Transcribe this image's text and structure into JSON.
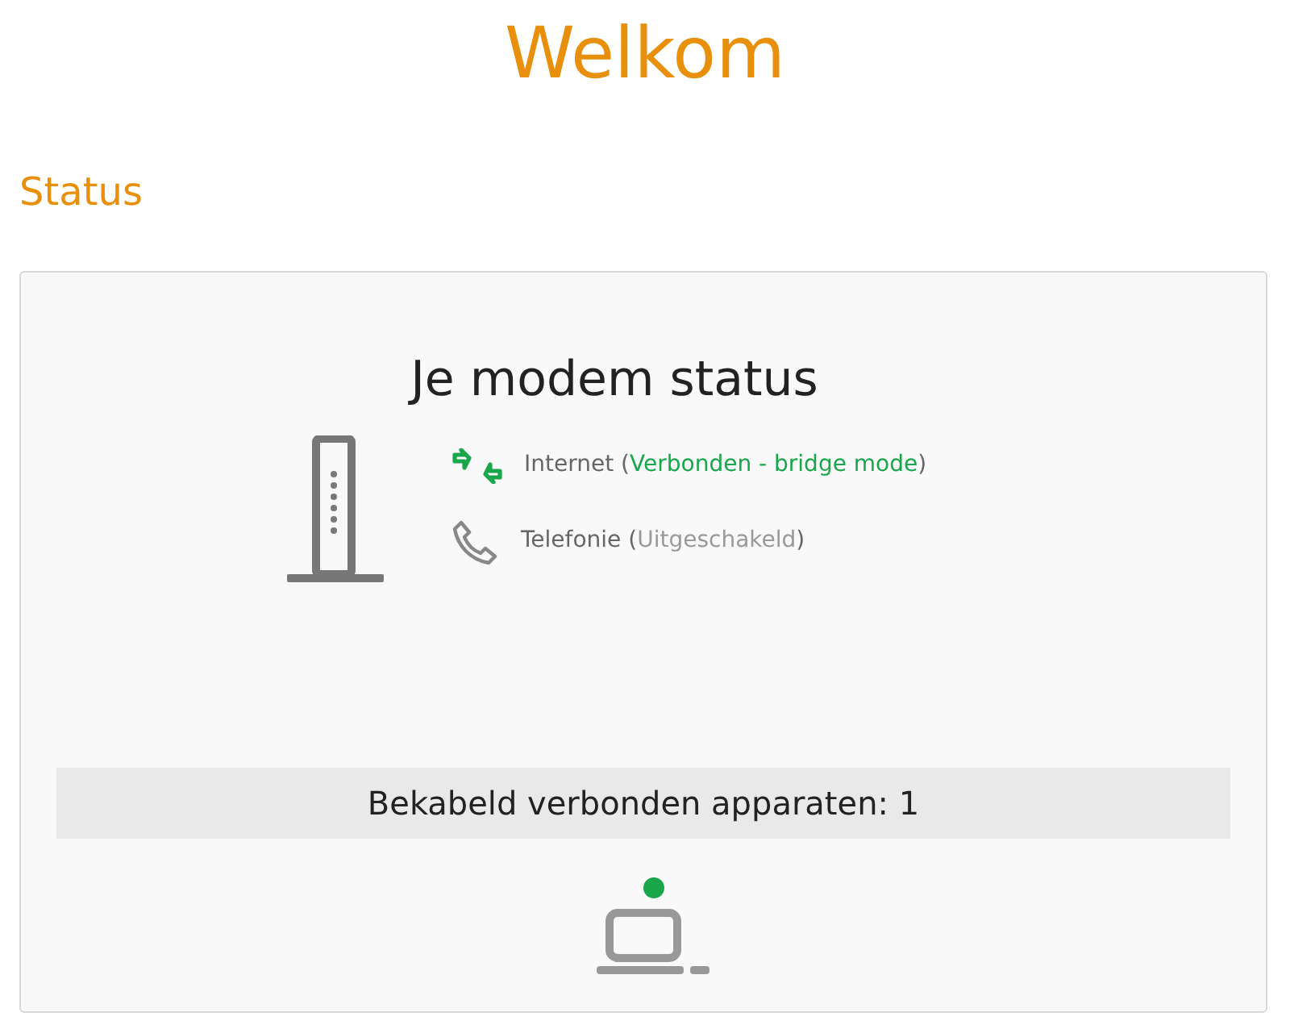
{
  "page_title": "Welkom",
  "section_title": "Status",
  "modem": {
    "title": "Je modem status",
    "services": [
      {
        "kind": "internet",
        "name": "Internet",
        "open": "(",
        "status": "Verbonden - bridge mode",
        "close": ")",
        "connected": true
      },
      {
        "kind": "phone",
        "name": "Telefonie",
        "open": "(",
        "status": "Uitgeschakeld",
        "close": ")",
        "connected": false
      }
    ]
  },
  "wired": {
    "label": "Bekabeld verbonden apparaten: 1",
    "devices": [
      {
        "color": "#1aa64a"
      }
    ]
  }
}
